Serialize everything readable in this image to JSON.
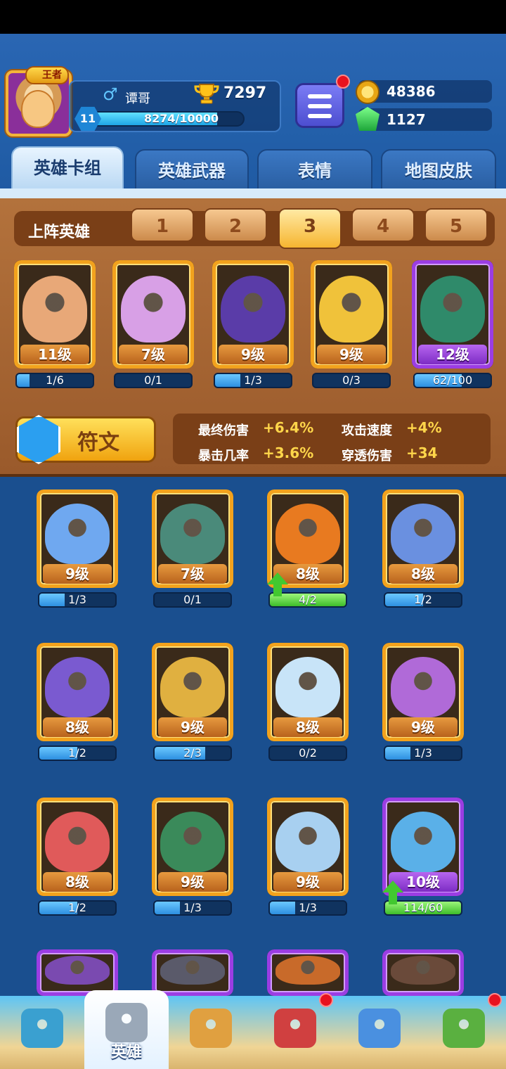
{
  "player": {
    "rank_badge": "王者",
    "gender_symbol": "♂",
    "name": "谭哥",
    "trophies": "7297",
    "level": "11",
    "xp": "8274/10000",
    "xp_fraction": 0.827
  },
  "currency": {
    "gold": "48386",
    "gems": "1127"
  },
  "tabs": [
    {
      "label": "英雄卡组",
      "active": true
    },
    {
      "label": "英雄武器",
      "active": false
    },
    {
      "label": "表情",
      "active": false
    },
    {
      "label": "地图皮肤",
      "active": false
    }
  ],
  "lineup": {
    "label": "上阵英雄",
    "slots": [
      "1",
      "2",
      "3",
      "4",
      "5"
    ],
    "active_slot": "3"
  },
  "deployed_heroes": [
    {
      "level": "11级",
      "progress": "1/6",
      "fraction": 0.17,
      "icon": "monkey-king-hero-icon",
      "color": "#e8a878",
      "frame": "gold"
    },
    {
      "level": "7级",
      "progress": "0/1",
      "fraction": 0.0,
      "icon": "fan-girl-hero-icon",
      "color": "#d8a0e6",
      "frame": "gold"
    },
    {
      "level": "9级",
      "progress": "1/3",
      "fraction": 0.33,
      "icon": "hooded-mage-hero-icon",
      "color": "#5a3ca8",
      "frame": "gold"
    },
    {
      "level": "9级",
      "progress": "0/3",
      "fraction": 0.0,
      "icon": "chef-hero-icon",
      "color": "#f0c23a",
      "frame": "gold"
    },
    {
      "level": "12级",
      "progress": "62/100",
      "fraction": 0.62,
      "icon": "skull-hat-hero-icon",
      "color": "#2f8a6a",
      "frame": "purple"
    }
  ],
  "rune": {
    "label": "符文"
  },
  "stats": [
    {
      "name": "最终伤害",
      "value": "+6.4%"
    },
    {
      "name": "攻击速度",
      "value": "+4%"
    },
    {
      "name": "暴击几率",
      "value": "+3.6%"
    },
    {
      "name": "穿透伤害",
      "value": "+34"
    }
  ],
  "collection": [
    {
      "level": "9级",
      "progress": "1/3",
      "fraction": 0.33,
      "icon": "blue-hair-girl-hero-icon",
      "color": "#6fa8f0",
      "frame": "gold",
      "upgrade": false
    },
    {
      "level": "7级",
      "progress": "0/1",
      "fraction": 0.0,
      "icon": "police-zombie-hero-icon",
      "color": "#4a8a7a",
      "frame": "gold",
      "upgrade": false
    },
    {
      "level": "8级",
      "progress": "4/2",
      "fraction": 1.0,
      "icon": "flame-beard-hero-icon",
      "color": "#e87a20",
      "frame": "gold",
      "upgrade": true
    },
    {
      "level": "8级",
      "progress": "1/2",
      "fraction": 0.5,
      "icon": "ice-king-hero-icon",
      "color": "#6a90e0",
      "frame": "gold",
      "upgrade": false
    },
    {
      "level": "8级",
      "progress": "1/2",
      "fraction": 0.5,
      "icon": "octopus-pirate-hero-icon",
      "color": "#7a5ad0",
      "frame": "gold",
      "upgrade": false
    },
    {
      "level": "9级",
      "progress": "2/3",
      "fraction": 0.67,
      "icon": "knight-helmet-hero-icon",
      "color": "#e0b040",
      "frame": "gold",
      "upgrade": false
    },
    {
      "level": "8级",
      "progress": "0/2",
      "fraction": 0.0,
      "icon": "yeti-hero-icon",
      "color": "#c8e4f8",
      "frame": "gold",
      "upgrade": false
    },
    {
      "level": "9级",
      "progress": "1/3",
      "fraction": 0.33,
      "icon": "skull-mage-hero-icon",
      "color": "#b06ad8",
      "frame": "gold",
      "upgrade": false
    },
    {
      "level": "8级",
      "progress": "1/2",
      "fraction": 0.5,
      "icon": "red-monocle-hero-icon",
      "color": "#e05a5a",
      "frame": "gold",
      "upgrade": false
    },
    {
      "level": "9级",
      "progress": "1/3",
      "fraction": 0.33,
      "icon": "green-goggles-hero-icon",
      "color": "#3a8a5a",
      "frame": "gold",
      "upgrade": false
    },
    {
      "level": "9级",
      "progress": "1/3",
      "fraction": 0.33,
      "icon": "zeus-hero-icon",
      "color": "#a8d0f0",
      "frame": "gold",
      "upgrade": false
    },
    {
      "level": "10级",
      "progress": "114/60",
      "fraction": 1.0,
      "icon": "blue-elf-hero-icon",
      "color": "#5ab0e8",
      "frame": "purple",
      "upgrade": true
    },
    {
      "level": "",
      "progress": "",
      "fraction": 0.0,
      "icon": "purple-hat-hero-icon",
      "color": "#7a4ab0",
      "frame": "purple",
      "upgrade": false
    },
    {
      "level": "",
      "progress": "",
      "fraction": 0.0,
      "icon": "penguin-thief-hero-icon",
      "color": "#5a5a6a",
      "frame": "purple",
      "upgrade": false
    },
    {
      "level": "",
      "progress": "",
      "fraction": 0.0,
      "icon": "lava-golem-hero-icon",
      "color": "#c86a2a",
      "frame": "purple",
      "upgrade": false
    },
    {
      "level": "",
      "progress": "",
      "fraction": 0.0,
      "icon": "hooded-wizard-hero-icon",
      "color": "#6a4a3a",
      "frame": "purple",
      "upgrade": false
    }
  ],
  "nav": [
    {
      "label": "",
      "icon": "treasure-chest-icon",
      "color": "#3aa0d0",
      "badge": false,
      "active": false
    },
    {
      "label": "英雄",
      "icon": "knight-helmet-icon",
      "color": "#9aa8b8",
      "badge": false,
      "active": true
    },
    {
      "label": "",
      "icon": "crossed-swords-icon",
      "color": "#e0a040",
      "badge": false,
      "active": false
    },
    {
      "label": "",
      "icon": "crown-shield-icon",
      "color": "#d04040",
      "badge": true,
      "active": false
    },
    {
      "label": "",
      "icon": "friends-banner-icon",
      "color": "#4a90e0",
      "badge": false,
      "active": false
    },
    {
      "label": "",
      "icon": "sprout-island-icon",
      "color": "#5ab040",
      "badge": true,
      "active": false
    }
  ]
}
